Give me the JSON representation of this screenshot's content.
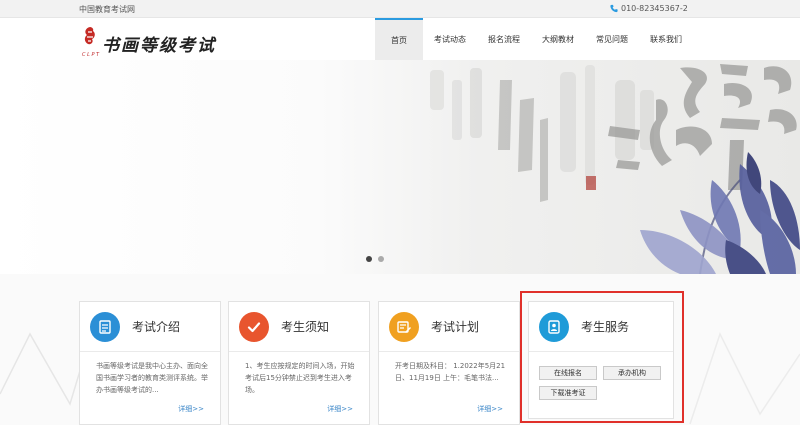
{
  "topbar": {
    "site_name": "中国教育考试网",
    "phone": "010-82345367-2"
  },
  "logo": {
    "title": "书画等级考试",
    "subtitle": "C L P T"
  },
  "nav": {
    "items": [
      {
        "label": "首页",
        "active": true
      },
      {
        "label": "考试动态"
      },
      {
        "label": "报名流程"
      },
      {
        "label": "大纲教材"
      },
      {
        "label": "常见问题"
      },
      {
        "label": "联系我们"
      }
    ]
  },
  "carousel": {
    "slides": 2,
    "current": 1
  },
  "cards": [
    {
      "title": "考试介绍",
      "icon": "document-icon",
      "color": "#2b8fd6",
      "text": "书画等级考试是我中心主办、面向全国书画学习者的教育类测评系统。举办书画等级考试的...",
      "more": "详细>>"
    },
    {
      "title": "考生须知",
      "icon": "checkmark-icon",
      "color": "#e8552e",
      "text": "1、考生应按规定的时间入场，开始考试后15分钟禁止迟到考生进入考场。",
      "more": "详细>>"
    },
    {
      "title": "考试计划",
      "icon": "calendar-edit-icon",
      "color": "#f0a020",
      "text": "开考日期及科目： 1.2022年5月21日、11月19日 上午：毛笔书法...",
      "more": "详细>>"
    }
  ],
  "service": {
    "title": "考生服务",
    "icon": "id-card-icon",
    "color": "#1f9bd8",
    "buttons": [
      "在线报名",
      "承办机构",
      "下载准考证"
    ]
  }
}
